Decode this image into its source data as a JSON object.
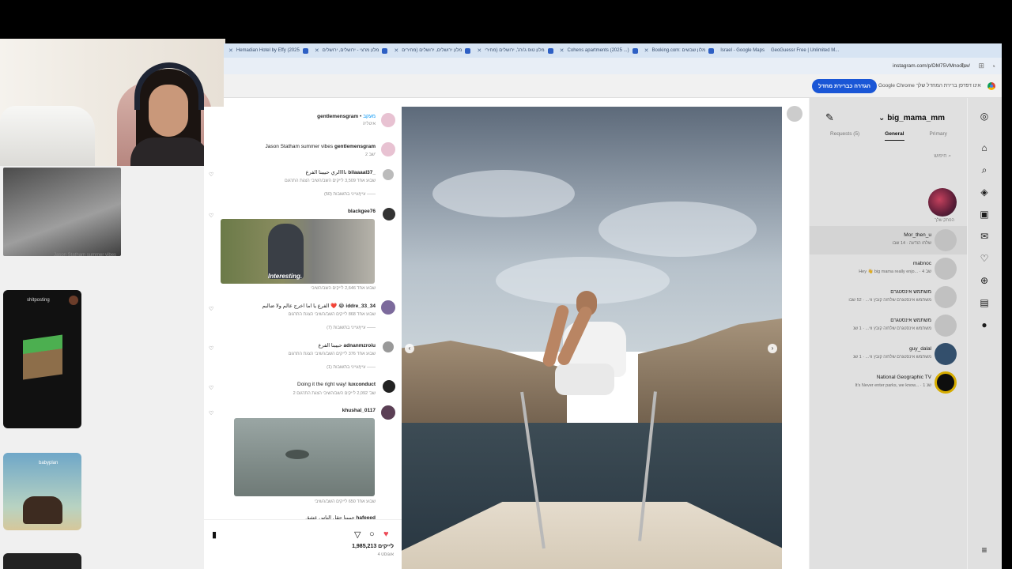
{
  "tabs": [
    {
      "label": "Hemadian Hotel by Effy (2025"
    },
    {
      "label": "מלון מרצי - ירושלים, ירושלים"
    },
    {
      "label": "מלון ירושלים, ירושלים (מחירים"
    },
    {
      "label": "מלון טופ ג'ורג', ירושלים (מחירי"
    },
    {
      "label": "Cohens apartments (2025 ...)"
    },
    {
      "label": "Booking.com: מלון שבשים"
    },
    {
      "label": "Israel - Google Maps"
    },
    {
      "label": "GeoGuessr Free | Unlimited M..."
    }
  ],
  "address": {
    "url": "instagram.com/p/DM75VMnoouw/"
  },
  "infobar": {
    "button": "הגדרה כברירת מחדל",
    "text": "Google Chrome אינו דפדפן ברירת המחדל שלך"
  },
  "left_feed": {
    "thumb_caption": "Jason Statham summer vibes",
    "reel1_user": "shitposting",
    "reel2_user": "babyplan"
  },
  "post": {
    "author": "gentlemensgram",
    "follow": "מעקב",
    "location": "איטליה",
    "caption_user": "gentlemensgram",
    "caption": "Jason Statham summer vibes",
    "caption_time": "2 שב'",
    "likes": "1,985,213 לייקים",
    "date": "4 אוגוסט"
  },
  "comments": [
    {
      "user": "bilaaaal37_",
      "text": "ناااالري حبيبنا الفرع",
      "meta": "שבוע אחד   3,509 לייקים   השב/השיבי   הצגת התרגום",
      "replies": "עיין/עייני בתשובות (50)"
    },
    {
      "user": "blackgee76",
      "text": "",
      "meta": "שבוע אחד   2,646 לייקים   השב/השיבי",
      "replies": "",
      "image_caption": "Interesting."
    },
    {
      "user": "iddre_33_34",
      "text": "الفرع يا اما اخرج عالم ولا ضالبم ❤️ 😂",
      "meta": "שבוע אחד   868 לייקים   השב/השיבי   הצגת התרגום",
      "replies": "עיין/עייני בתשובות (7)"
    },
    {
      "user": "adnanmzroiu",
      "text": "حبيبنا الفرع",
      "meta": "שבוע אחד   376 לייקים   השב/השיבי   הצגת התרגום",
      "replies": "עיין/עייני בתשובות (1)"
    },
    {
      "user": "luxconduct",
      "text": "Doing it the right way!",
      "meta": "2 שב'   2,092 לייקים   השב/השיבי   הצגת התרגום",
      "replies": ""
    },
    {
      "user": "khushal_0117",
      "text": "",
      "meta": "שבוע אחד   650 לייקים   השב/השיבי",
      "replies": ""
    },
    {
      "user": "hafeeed",
      "text": "حبيبنا حقل الناس عشق",
      "meta": "",
      "replies": ""
    }
  ],
  "dm": {
    "username": "big_mama_mm",
    "tabs": [
      "Primary",
      "General",
      "Requests (5)"
    ],
    "search_placeholder": "חיפוש",
    "my_note": "הפתק שלך",
    "conversations": [
      {
        "name": "Mor_then_u",
        "msg": "שלחו הודעה · 14 שבו"
      },
      {
        "name": "mabnoc",
        "msg": "Hey 👋 big mama really enjo... · 4 שב"
      },
      {
        "name": "משתמש אינסטגרם",
        "msg": "משתמש אינסטגרם שלח/ה קובץ ווי... · 52 שבו"
      },
      {
        "name": "משתמש אינסטגרם",
        "msg": "משתמש אינסטגרם שלח/ה קובץ ווי... · 1 שנ"
      },
      {
        "name": "guy_dalal",
        "msg": "משתמש אינסטגרם שלח/ה קובץ ווי... · 1 שנ"
      },
      {
        "name": "National Geographic TV",
        "msg": "It's Never enter parks, we know... · 1 שנ"
      }
    ]
  },
  "colors": {
    "accent": "#1a56d6",
    "like": "#ed4956"
  }
}
